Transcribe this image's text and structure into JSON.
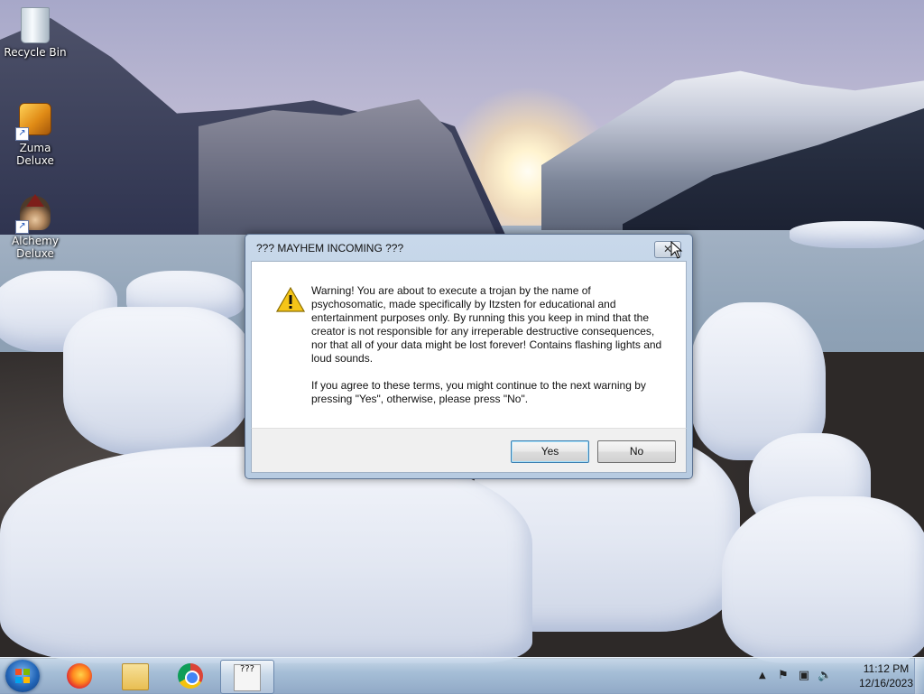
{
  "desktop": {
    "icons": [
      {
        "label": "Recycle Bin"
      },
      {
        "label": "Zuma Deluxe"
      },
      {
        "label": "Alchemy Deluxe"
      }
    ]
  },
  "dialog": {
    "title": "??? MAYHEM INCOMING ???",
    "close_label": "✕",
    "paragraph1": "Warning! You are about to execute a trojan by the name of psychosomatic, made specifically by Itzsten for educational and entertainment purposes only. By running this you keep in mind that the creator is not responsible for any irreperable destructive consequences, nor that all of your data might be lost forever! Contains flashing lights and loud sounds.",
    "paragraph2": "If you agree to these terms, you might continue to the next warning by pressing \"Yes\", otherwise, please press \"No\".",
    "yes_label": "Yes",
    "no_label": "No",
    "icon": "warning-icon"
  },
  "taskbar": {
    "apps": [
      {
        "name": "firefox-icon"
      },
      {
        "name": "file-explorer-icon"
      },
      {
        "name": "chrome-icon"
      },
      {
        "name": "mayhem-app-icon",
        "active": true
      }
    ],
    "mayhem_glyph": "???",
    "tray": {
      "overflow": "▲",
      "flag": "⚑",
      "network": "▣",
      "volume": "🔈"
    },
    "clock": {
      "time": "11:12 PM",
      "date": "12/16/2023"
    }
  },
  "colors": {
    "dialog_frame": "#c8d8ea",
    "accent_button_border": "#3c7fb1",
    "warning_yellow": "#f5c518"
  }
}
